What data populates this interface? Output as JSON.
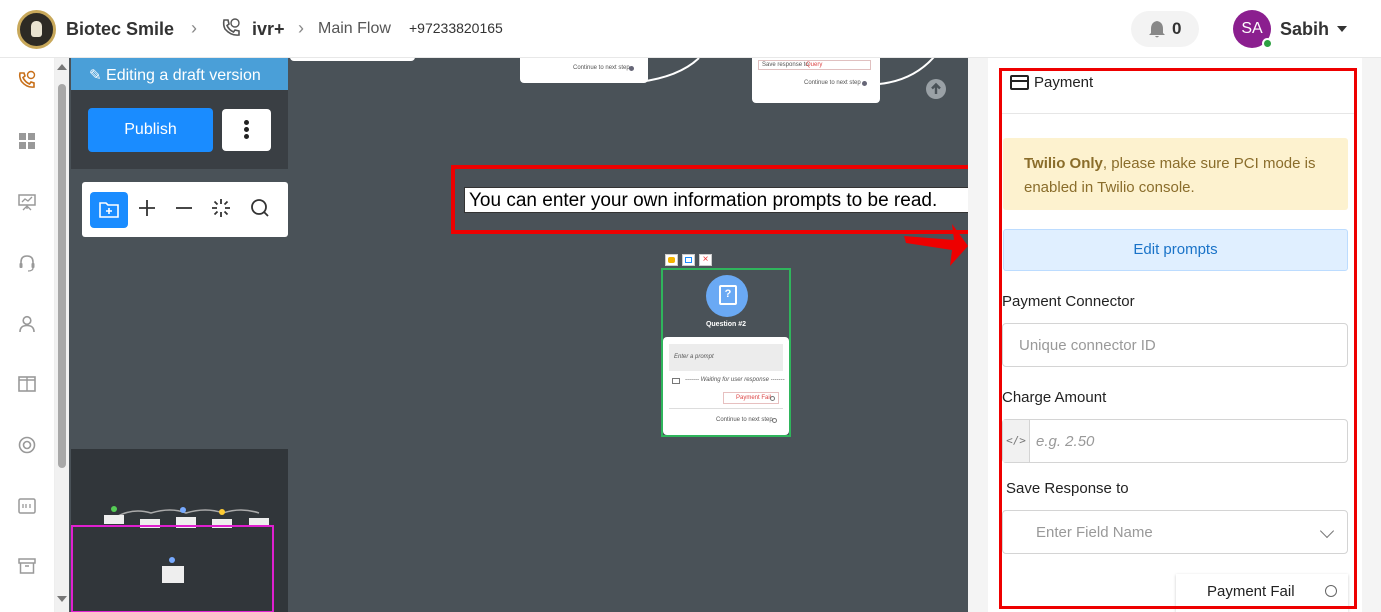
{
  "header": {
    "company": "Biotec Smile",
    "ivr_label": "ivr+",
    "flow_label": "Main Flow",
    "phone": "+97233820165",
    "notifications": "0",
    "avatar_initials": "SA",
    "user_name": "Sabih"
  },
  "sidebar": {
    "icons": [
      "ivr-icon",
      "dashboard-icon",
      "presentation-icon",
      "headset-icon",
      "user-icon",
      "book-icon",
      "lifebuoy-icon",
      "keyboard-icon",
      "archive-icon"
    ]
  },
  "canvas": {
    "draft_label": "Editing a draft version",
    "publish_label": "Publish",
    "node_top_left": {
      "text": "Continue to next step"
    },
    "node_top_right": {
      "save_text": "Save response to",
      "save_query": "Query",
      "continue_text": "Continue to next step"
    },
    "question_node": {
      "title": "Question #2",
      "prompt_placeholder": "Enter a prompt",
      "waiting": "------- Waiting for user response -------",
      "payment_fail": "Payment Fail",
      "continue": "Continue to next step"
    },
    "callout": "You can enter your own information prompts to be read."
  },
  "panel": {
    "title": "Payment",
    "alert_bold": "Twilio Only",
    "alert_rest": ", please make sure PCI mode is enabled in Twilio console.",
    "edit_prompts": "Edit prompts",
    "connector_label": "Payment Connector",
    "connector_placeholder": "Unique connector ID",
    "amount_label": "Charge Amount",
    "amount_placeholder": "e.g. 2.50",
    "save_label": "Save Response to",
    "save_placeholder": "Enter Field Name",
    "payment_fail": "Payment Fail"
  },
  "colors": {
    "accent": "#1a8cff",
    "canvas_bg": "#4a5258",
    "highlight": "#e00000",
    "alert_bg": "#fdf2cf",
    "node_border": "#2fb55c"
  }
}
